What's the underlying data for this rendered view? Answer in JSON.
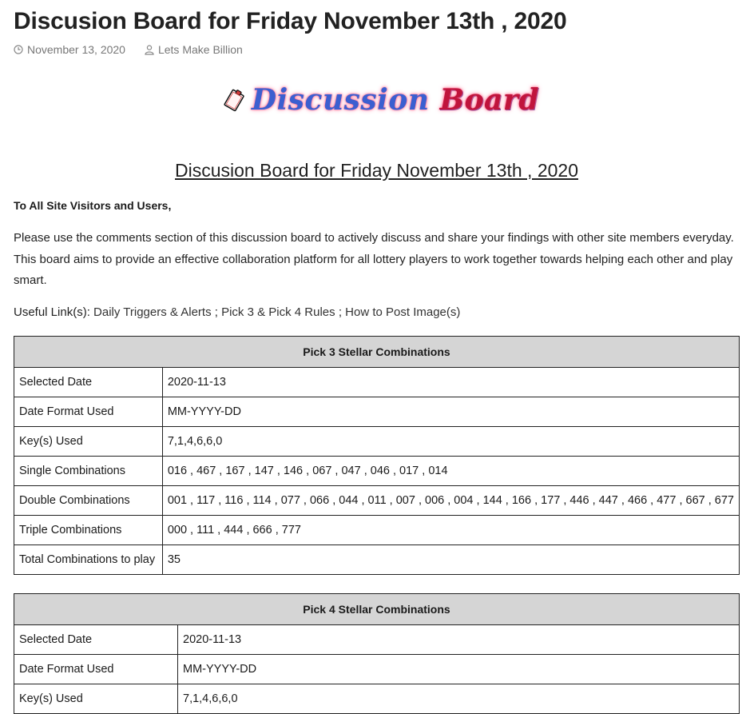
{
  "post": {
    "title": "Discusion Board for Friday November 13th , 2020",
    "date": "November 13, 2020",
    "author": "Lets Make Billion"
  },
  "banner": {
    "word1": "Discussion",
    "word2": "Board",
    "icon": "clipboard-icon"
  },
  "content": {
    "heading": "Discusion Board for Friday November 13th , 2020",
    "greeting": "To All Site Visitors and Users,",
    "intro": "Please use the comments section of this discussion board to actively discuss and share your findings with other site members everyday. This board aims to provide an effective collaboration platform for all lottery players to work together towards helping each other and play smart.",
    "links_label": "Useful Link(s):",
    "links": [
      {
        "text": "Daily Triggers & Alerts"
      },
      {
        "text": "Pick 3 & Pick 4 Rules"
      },
      {
        "text": "How to Post Image(s)"
      }
    ],
    "link_separator": " ; "
  },
  "pick3": {
    "title": "Pick 3 Stellar Combinations",
    "rows": [
      {
        "label": "Selected Date",
        "value": "2020-11-13"
      },
      {
        "label": "Date Format Used",
        "value": "MM-YYYY-DD"
      },
      {
        "label": "Key(s) Used",
        "value": "7,1,4,6,6,0"
      },
      {
        "label": "Single Combinations",
        "value": "016 , 467 , 167 , 147 , 146 , 067 , 047 , 046 , 017 , 014"
      },
      {
        "label": "Double Combinations",
        "value": "001 , 117 , 116 , 114 , 077 , 066 , 044 , 011 , 007 , 006 , 004 , 144 , 166 , 177 , 446 , 447 , 466 , 477 , 667 , 677"
      },
      {
        "label": "Triple Combinations",
        "value": "000 , 111 , 444 , 666 , 777"
      },
      {
        "label": "Total Combinations to play",
        "value": "35"
      }
    ]
  },
  "pick4": {
    "title": "Pick 4 Stellar Combinations",
    "rows": [
      {
        "label": "Selected Date",
        "value": "2020-11-13"
      },
      {
        "label": "Date Format Used",
        "value": "MM-YYYY-DD"
      },
      {
        "label": "Key(s) Used",
        "value": "7,1,4,6,6,0"
      }
    ]
  }
}
